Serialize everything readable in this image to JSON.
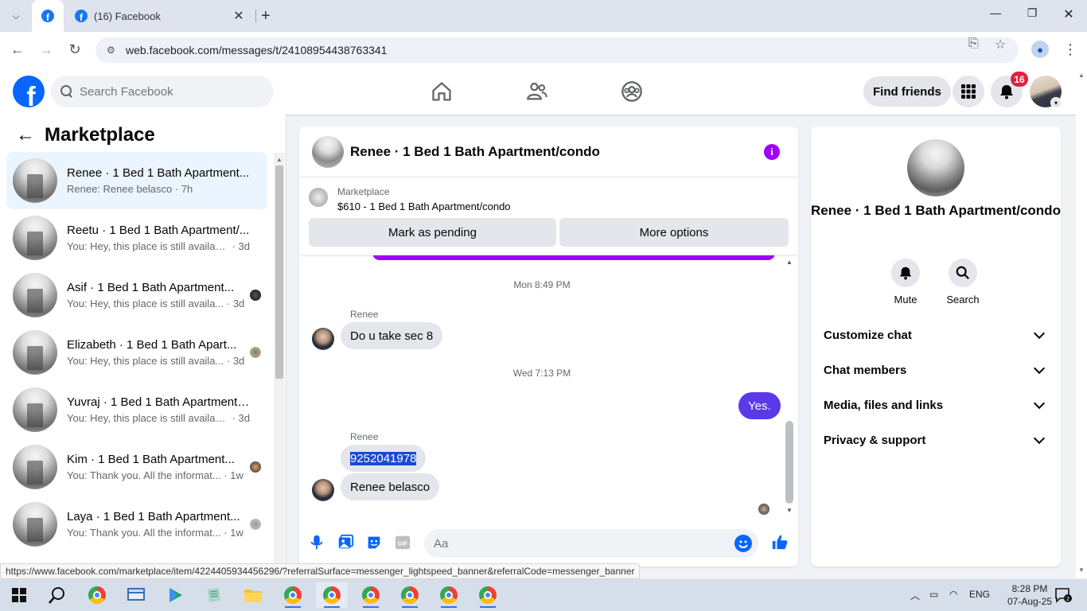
{
  "browser": {
    "tab_title": "(16) Facebook",
    "url": "web.facebook.com/messages/t/24108954438763341",
    "status_url": "https://www.facebook.com/marketplace/item/4224405934456296/?referralSurface=messenger_lightspeed_banner&referralCode=messenger_banner"
  },
  "header": {
    "logo_letter": "f",
    "search_placeholder": "Search Facebook",
    "find_friends": "Find friends",
    "notification_count": "16"
  },
  "left": {
    "title": "Marketplace",
    "conversations": [
      {
        "name": "Renee · 1 Bed 1 Bath Apartment...",
        "preview": "Renee: Renee belasco",
        "time": "7h"
      },
      {
        "name": "Reetu · 1 Bed 1 Bath Apartment/...",
        "preview": "You: Hey, this place is still available....",
        "time": "3d"
      },
      {
        "name": "Asif · 1 Bed 1 Bath Apartment...",
        "preview": "You: Hey, this place is still availa...",
        "time": "3d"
      },
      {
        "name": "Elizabeth · 1 Bed 1 Bath Apart...",
        "preview": "You: Hey, this place is still availa...",
        "time": "3d"
      },
      {
        "name": "Yuvraj · 1 Bed 1 Bath Apartment/...",
        "preview": "You: Hey, this place is still available....",
        "time": "3d"
      },
      {
        "name": "Kim · 1 Bed 1 Bath Apartment...",
        "preview": "You: Thank you. All the informat...",
        "time": "1w"
      },
      {
        "name": "Laya · 1 Bed 1 Bath Apartment...",
        "preview": "You: Thank you. All the informat...",
        "time": "1w"
      }
    ]
  },
  "chat": {
    "title": "Renee · 1 Bed 1 Bath Apartment/condo",
    "marketplace_label": "Marketplace",
    "listing": "$610 - 1 Bed 1 Bath Apartment/condo",
    "mark_pending": "Mark as pending",
    "more_options": "More options",
    "ts1": "Mon 8:49 PM",
    "sender1": "Renee",
    "msg1": "Do u take sec 8",
    "ts2": "Wed 7:13 PM",
    "msg_out": "Yes.",
    "sender2": "Renee",
    "msg2": "9252041978",
    "msg3": "Renee belasco",
    "composer_placeholder": "Aa"
  },
  "right": {
    "name": "Renee · 1 Bed 1 Bath Apartment/condo",
    "mute": "Mute",
    "search": "Search",
    "sections": [
      "Customize chat",
      "Chat members",
      "Media, files and links",
      "Privacy & support"
    ]
  },
  "taskbar": {
    "lang": "ENG",
    "time": "8:28 PM",
    "date": "07-Aug-25",
    "notif_count": "2"
  }
}
